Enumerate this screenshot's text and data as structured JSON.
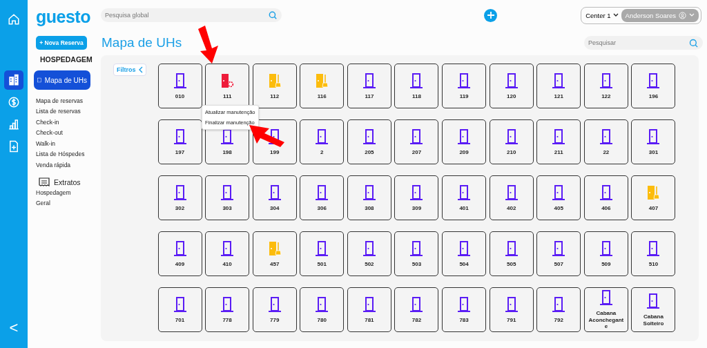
{
  "logo": "guesto",
  "rail": [
    {
      "kind": "home",
      "selected": false
    },
    {
      "kind": "building",
      "selected": true
    },
    {
      "kind": "money",
      "selected": false
    },
    {
      "kind": "chart",
      "selected": false
    },
    {
      "kind": "file",
      "selected": false
    }
  ],
  "rail_back": "<",
  "top": {
    "search_placeholder": "Pesquisa global",
    "unit": "Center 1",
    "user": "Anderson Soares"
  },
  "sidebar": {
    "new_button": "+ Nova Reserva",
    "section": "HOSPEDAGEM",
    "items": [
      {
        "label": "Mapa de UHs",
        "selected": true
      },
      {
        "label": "Mapa de reservas",
        "selected": false
      },
      {
        "label": "Lista de reservas",
        "selected": false
      },
      {
        "label": "Check-in",
        "selected": false
      },
      {
        "label": "Check-out",
        "selected": false
      },
      {
        "label": "Walk-in",
        "selected": false
      },
      {
        "label": "Lista de Hóspedes",
        "selected": false
      },
      {
        "label": "Venda rápida",
        "selected": false
      }
    ],
    "group": "Extratos",
    "group_items": [
      "Hospedagem",
      "Geral"
    ]
  },
  "page": {
    "title": "Mapa de UHs",
    "search_placeholder": "Pesquisar",
    "filters": "Filtros"
  },
  "rooms": [
    {
      "label": "010",
      "kind": "free"
    },
    {
      "label": "111",
      "kind": "maintenance"
    },
    {
      "label": "112",
      "kind": "cleaning"
    },
    {
      "label": "116",
      "kind": "cleaning"
    },
    {
      "label": "117",
      "kind": "free"
    },
    {
      "label": "118",
      "kind": "free"
    },
    {
      "label": "119",
      "kind": "free"
    },
    {
      "label": "120",
      "kind": "free"
    },
    {
      "label": "121",
      "kind": "free"
    },
    {
      "label": "122",
      "kind": "free"
    },
    {
      "label": "196",
      "kind": "free"
    },
    {
      "label": "197",
      "kind": "free"
    },
    {
      "label": "198",
      "kind": "free"
    },
    {
      "label": "199",
      "kind": "free"
    },
    {
      "label": "2",
      "kind": "free"
    },
    {
      "label": "205",
      "kind": "free"
    },
    {
      "label": "207",
      "kind": "free"
    },
    {
      "label": "209",
      "kind": "free"
    },
    {
      "label": "210",
      "kind": "free"
    },
    {
      "label": "211",
      "kind": "free"
    },
    {
      "label": "22",
      "kind": "free"
    },
    {
      "label": "301",
      "kind": "free"
    },
    {
      "label": "302",
      "kind": "free"
    },
    {
      "label": "303",
      "kind": "free"
    },
    {
      "label": "304",
      "kind": "free"
    },
    {
      "label": "306",
      "kind": "free"
    },
    {
      "label": "308",
      "kind": "free"
    },
    {
      "label": "309",
      "kind": "free"
    },
    {
      "label": "401",
      "kind": "free"
    },
    {
      "label": "402",
      "kind": "free"
    },
    {
      "label": "405",
      "kind": "free"
    },
    {
      "label": "406",
      "kind": "free"
    },
    {
      "label": "407",
      "kind": "cleaning"
    },
    {
      "label": "409",
      "kind": "free"
    },
    {
      "label": "410",
      "kind": "free"
    },
    {
      "label": "457",
      "kind": "cleaning"
    },
    {
      "label": "501",
      "kind": "free"
    },
    {
      "label": "502",
      "kind": "free"
    },
    {
      "label": "503",
      "kind": "free"
    },
    {
      "label": "504",
      "kind": "free"
    },
    {
      "label": "505",
      "kind": "free"
    },
    {
      "label": "507",
      "kind": "free"
    },
    {
      "label": "509",
      "kind": "free"
    },
    {
      "label": "510",
      "kind": "free"
    },
    {
      "label": "701",
      "kind": "free"
    },
    {
      "label": "778",
      "kind": "free"
    },
    {
      "label": "779",
      "kind": "free"
    },
    {
      "label": "780",
      "kind": "free"
    },
    {
      "label": "781",
      "kind": "free"
    },
    {
      "label": "782",
      "kind": "free"
    },
    {
      "label": "783",
      "kind": "free"
    },
    {
      "label": "791",
      "kind": "free"
    },
    {
      "label": "792",
      "kind": "free"
    },
    {
      "label": "Cabana Aconchegant e",
      "kind": "free"
    },
    {
      "label": "Cabana Solteiro",
      "kind": "free"
    }
  ],
  "context_menu": [
    "Atualizar manutenção",
    "Finalizar manutenção"
  ]
}
